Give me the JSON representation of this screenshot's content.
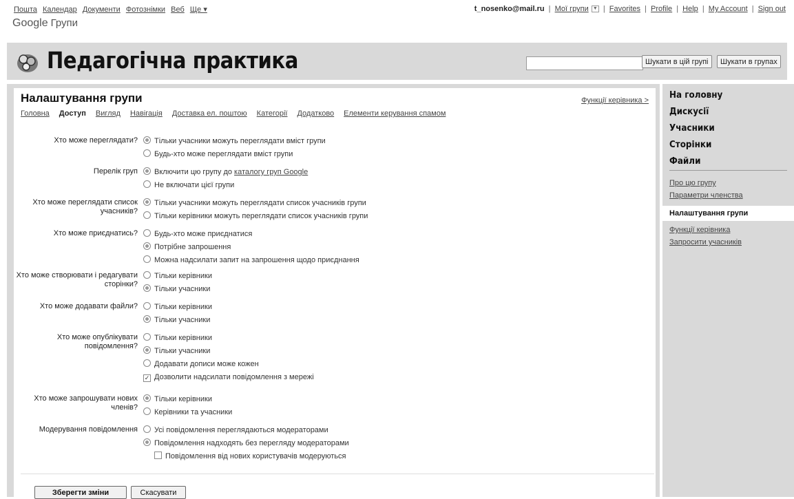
{
  "topnav": {
    "items": [
      "Пошта",
      "Календар",
      "Документи",
      "Фотознімки",
      "Веб",
      "Ще ▾"
    ],
    "email": "t_nosenko@mail.ru",
    "my_groups": "Мої групи",
    "links": [
      "Favorites",
      "Profile",
      "Help",
      "My Account",
      "Sign out"
    ]
  },
  "logo": {
    "google": "Google",
    "groups": "Групи"
  },
  "header": {
    "group_title": "Педагогічна практика",
    "search_placeholder": "",
    "search_this_group": "Шукати в цій групі",
    "search_groups": "Шукати в групах"
  },
  "page": {
    "title": "Налаштування групи",
    "manager_link": "Функції керівника >",
    "tabs": [
      "Головна",
      "Доступ",
      "Вигляд",
      "Навігація",
      "Доставка ел. поштою",
      "Категорії",
      "Додатково",
      "Елементи керування спамом"
    ],
    "active_tab": "Доступ"
  },
  "settings": [
    {
      "label": "Хто може переглядати?",
      "options": [
        {
          "type": "radio",
          "checked": true,
          "text": "Тільки учасники можуть переглядати вміст групи"
        },
        {
          "type": "radio",
          "checked": false,
          "text": "Будь-хто може переглядати вміст групи"
        }
      ]
    },
    {
      "label": "Перелік груп",
      "options": [
        {
          "type": "radio",
          "checked": true,
          "text": "Включити цю групу до ",
          "link": "каталогу груп Google"
        },
        {
          "type": "radio",
          "checked": false,
          "text": "Не включати цієї групи"
        }
      ]
    },
    {
      "label": "Хто може переглядати список учасників?",
      "options": [
        {
          "type": "radio",
          "checked": true,
          "text": "Тільки учасники можуть переглядати список учасників групи"
        },
        {
          "type": "radio",
          "checked": false,
          "text": "Тільки керівники можуть переглядати список учасників групи"
        }
      ]
    },
    {
      "label": "Хто може приєднатись?",
      "options": [
        {
          "type": "radio",
          "checked": false,
          "text": "Будь-хто може приєднатися"
        },
        {
          "type": "radio",
          "checked": true,
          "text": "Потрібне запрошення"
        },
        {
          "type": "radio",
          "checked": false,
          "text": "Можна надсилати запит на запрошення щодо приєднання"
        }
      ]
    },
    {
      "label": "Хто може створювати і редагувати сторінки?",
      "options": [
        {
          "type": "radio",
          "checked": false,
          "text": "Тільки керівники"
        },
        {
          "type": "radio",
          "checked": true,
          "text": "Тільки учасники"
        }
      ]
    },
    {
      "label": "Хто може додавати файли?",
      "options": [
        {
          "type": "radio",
          "checked": false,
          "text": "Тільки керівники"
        },
        {
          "type": "radio",
          "checked": true,
          "text": "Тільки учасники"
        }
      ]
    },
    {
      "label": "Хто може опублікувати повідомлення?",
      "options": [
        {
          "type": "radio",
          "checked": false,
          "text": "Тільки керівники"
        },
        {
          "type": "radio",
          "checked": true,
          "text": "Тільки учасники"
        },
        {
          "type": "radio",
          "checked": false,
          "text": "Додавати дописи може кожен"
        },
        {
          "type": "checkbox",
          "checked": true,
          "text": "Дозволити надсилати повідомлення з мережі"
        }
      ]
    },
    {
      "label": "Хто може запрошувати нових членів?",
      "options": [
        {
          "type": "radio",
          "checked": true,
          "text": "Тільки керівники"
        },
        {
          "type": "radio",
          "checked": false,
          "text": "Керівники та учасники"
        }
      ]
    },
    {
      "label": "Модерування повідомлення",
      "options": [
        {
          "type": "radio",
          "checked": false,
          "text": "Усі повідомлення переглядаються модераторами"
        },
        {
          "type": "radio",
          "checked": true,
          "text": "Повідомлення надходять без перегляду модераторами"
        },
        {
          "type": "checkbox",
          "checked": false,
          "indent": true,
          "text": "Повідомлення від нових користувачів модеруються"
        }
      ]
    }
  ],
  "buttons": {
    "save": "Зберегти зміни",
    "cancel": "Скасувати"
  },
  "sidebar": {
    "main_links": [
      "На головну",
      "Дискусії",
      "Учасники",
      "Сторінки",
      "Файли"
    ],
    "links_top": [
      "Про цю групу",
      "Параметри членства"
    ],
    "selected": "Налаштування групи",
    "links_bottom": [
      "Функції керівника",
      "Запросити учасників"
    ]
  }
}
